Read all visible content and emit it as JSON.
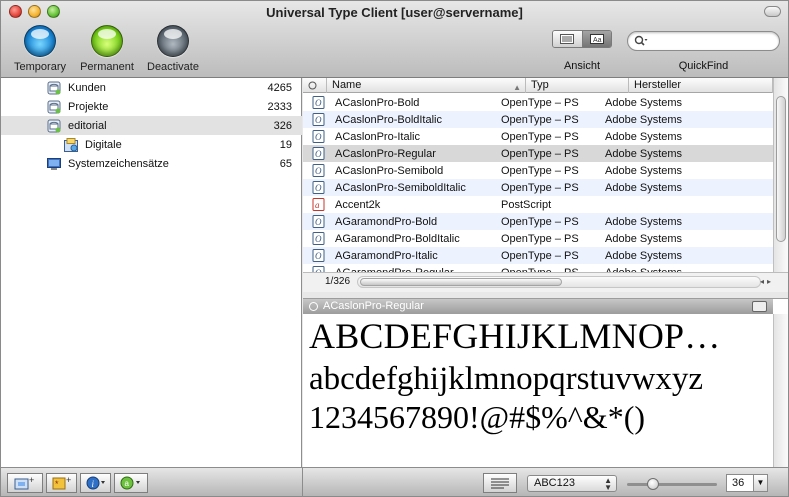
{
  "window": {
    "title": "Universal Type Client [user@servername]"
  },
  "toolbar": {
    "temporary_label": "Temporary",
    "permanent_label": "Permanent",
    "deactivate_label": "Deactivate",
    "view_label": "Ansicht",
    "quickfind_label": "QuickFind",
    "search_value": ""
  },
  "sidebar": {
    "items": [
      {
        "name": "Kunden",
        "count": "4265",
        "icon": "set-icon",
        "indent": 0,
        "selected": false
      },
      {
        "name": "Projekte",
        "count": "2333",
        "icon": "set-icon",
        "indent": 0,
        "selected": false
      },
      {
        "name": "editorial",
        "count": "326",
        "icon": "set-icon",
        "indent": 0,
        "selected": true
      },
      {
        "name": "Digitale",
        "count": "19",
        "icon": "subset-icon",
        "indent": 1,
        "selected": false
      },
      {
        "name": "Systemzeichensätze",
        "count": "65",
        "icon": "system-fonts-icon",
        "indent": 0,
        "selected": false
      }
    ]
  },
  "font_table": {
    "columns": {
      "name": "Name",
      "type": "Typ",
      "vendor": "Hersteller"
    },
    "rows": [
      {
        "name": "ACaslonPro-Bold",
        "type": "OpenType – PS",
        "vendor": "Adobe Systems",
        "icon": "opentype-icon",
        "selected": false
      },
      {
        "name": "ACaslonPro-BoldItalic",
        "type": "OpenType – PS",
        "vendor": "Adobe Systems",
        "icon": "opentype-icon",
        "selected": false
      },
      {
        "name": "ACaslonPro-Italic",
        "type": "OpenType – PS",
        "vendor": "Adobe Systems",
        "icon": "opentype-icon",
        "selected": false
      },
      {
        "name": "ACaslonPro-Regular",
        "type": "OpenType – PS",
        "vendor": "Adobe Systems",
        "icon": "opentype-icon",
        "selected": true
      },
      {
        "name": "ACaslonPro-Semibold",
        "type": "OpenType – PS",
        "vendor": "Adobe Systems",
        "icon": "opentype-icon",
        "selected": false
      },
      {
        "name": "ACaslonPro-SemiboldItalic",
        "type": "OpenType – PS",
        "vendor": "Adobe Systems",
        "icon": "opentype-icon",
        "selected": false
      },
      {
        "name": "Accent2k",
        "type": "PostScript",
        "vendor": "",
        "icon": "postscript-icon",
        "selected": false
      },
      {
        "name": "AGaramondPro-Bold",
        "type": "OpenType – PS",
        "vendor": "Adobe Systems",
        "icon": "opentype-icon",
        "selected": false
      },
      {
        "name": "AGaramondPro-BoldItalic",
        "type": "OpenType – PS",
        "vendor": "Adobe Systems",
        "icon": "opentype-icon",
        "selected": false
      },
      {
        "name": "AGaramondPro-Italic",
        "type": "OpenType – PS",
        "vendor": "Adobe Systems",
        "icon": "opentype-icon",
        "selected": false
      },
      {
        "name": "AGaramondPro-Regular",
        "type": "OpenType – PS",
        "vendor": "Adobe Systems",
        "icon": "opentype-icon",
        "selected": false
      }
    ],
    "count": "1/326"
  },
  "preview": {
    "font_name": "ACaslonPro-Regular",
    "line_upper": "ABCDEFGHIJKLMNOP…",
    "line_lower": "abcdefghijklmnopqrstuvwxyz",
    "line_digits": "1234567890!@#$%^&*()"
  },
  "bottombar": {
    "sample_text": "ABC123",
    "font_size": "36",
    "size_slider_fraction": 0.25
  },
  "colors": {
    "row_alt": "#edf3fe",
    "row_selected": "#d8d8d8",
    "sidebar_selected": "#e2e2e2",
    "opentype_icon": "#3f5f86",
    "postscript_icon": "#c8342a"
  }
}
